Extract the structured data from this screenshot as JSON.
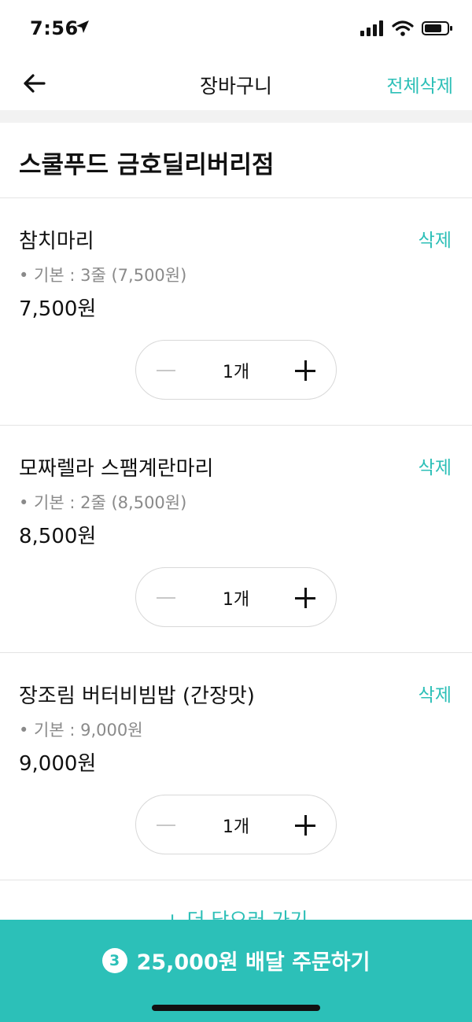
{
  "status": {
    "time": "7:56"
  },
  "nav": {
    "title": "장바구니",
    "clear_all": "전체삭제"
  },
  "store": {
    "name": "스쿨푸드 금호딜리버리점"
  },
  "items": [
    {
      "name": "참치마리",
      "option": "• 기본 : 3줄 (7,500원)",
      "price": "7,500원",
      "quantity": "1개",
      "delete_label": "삭제"
    },
    {
      "name": "모짜렐라 스팸계란마리",
      "option": "• 기본 : 2줄 (8,500원)",
      "price": "8,500원",
      "quantity": "1개",
      "delete_label": "삭제"
    },
    {
      "name": "장조림 버터비빔밥 (간장맛)",
      "option": "• 기본 : 9,000원",
      "price": "9,000원",
      "quantity": "1개",
      "delete_label": "삭제"
    }
  ],
  "add_more": "+ 더 담으러 가기",
  "order": {
    "count": "3",
    "label": "25,000원 배달 주문하기"
  },
  "colors": {
    "accent": "#2cbfb7",
    "order_bar": "#2cc0b8"
  }
}
